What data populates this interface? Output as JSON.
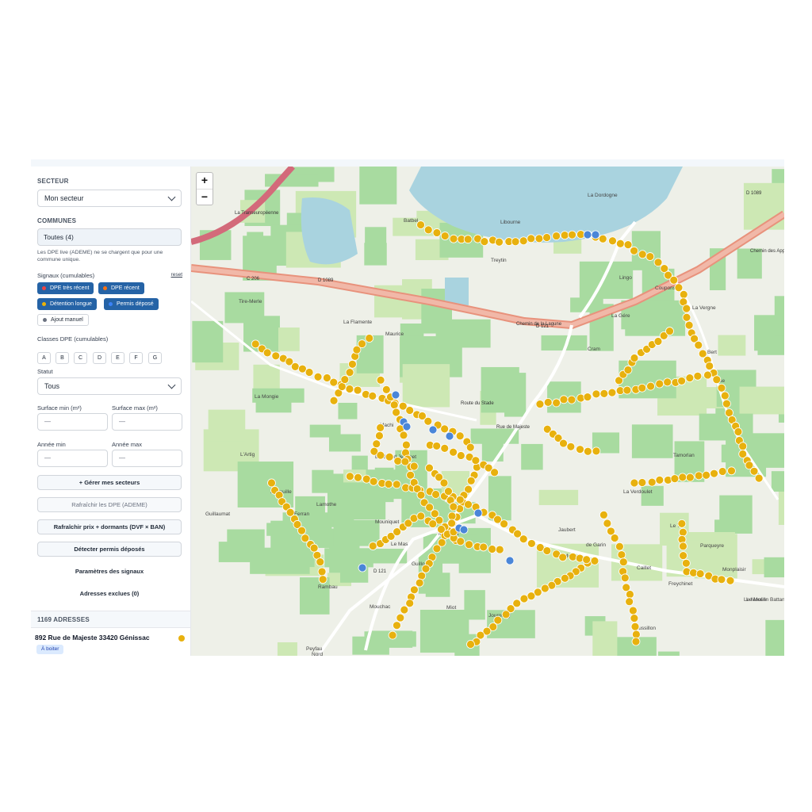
{
  "sidebar": {
    "secteur_label": "SECTEUR",
    "secteur_value": "Mon secteur",
    "communes_label": "COMMUNES",
    "communes_value": "Toutes (4)",
    "communes_note": "Les DPE live (ADEME) ne se chargent que pour une commune unique.",
    "signaux_label": "Signaux (cumulables)",
    "reset_label": "reset",
    "signals": [
      {
        "label": "DPE très récent",
        "dot": "#ef4444"
      },
      {
        "label": "DPE récent",
        "dot": "#f97316"
      },
      {
        "label": "Détention longue",
        "dot": "#eab308"
      },
      {
        "label": "Permis déposé",
        "dot": "#3b82f6"
      },
      {
        "label": "Ajout manuel",
        "dot": "#6b7280"
      }
    ],
    "classes_label": "Classes DPE (cumulables)",
    "classes": [
      "A",
      "B",
      "C",
      "D",
      "E",
      "F",
      "G"
    ],
    "statut_label": "Statut",
    "statut_value": "Tous",
    "surface_min_label": "Surface min (m²)",
    "surface_max_label": "Surface max (m²)",
    "surface_min_placeholder": "—",
    "surface_max_placeholder": "—",
    "annee_min_label": "Année min",
    "annee_max_label": "Année max",
    "annee_min_placeholder": "—",
    "annee_max_placeholder": "—",
    "buttons": {
      "gerer": "+ Gérer mes secteurs",
      "rafraichir_dpe": "Rafraîchir les DPE (ADEME)",
      "rafraichir_prix": "Rafraîchir prix + dormants (DVF × BAN)",
      "detecter": "Détecter permis déposés",
      "parametres": "Paramètres des signaux",
      "exclues": "Adresses exclues (0)"
    },
    "count_label": "1169 ADRESSES",
    "first_address": "892 Rue de Majeste 33420 Génissac",
    "first_address_badge": "À boiter",
    "first_address_dot": "#e8b10e"
  },
  "map": {
    "zoom_in": "+",
    "zoom_out": "−",
    "colors": {
      "detention": "#e8b10e",
      "permis": "#4a86d8",
      "vineyard": "#a8dba0",
      "field": "#cde8b4",
      "water": "#a9d3df",
      "motorway": "#e8927c"
    },
    "labels": [
      "La Dordogne",
      "Libourne",
      "Batbel",
      "Treytin",
      "Tire-Merle",
      "La Flamente",
      "Maurice",
      "La Mongie",
      "L'Artig",
      "Larreuille",
      "Lamothe",
      "Ferran",
      "Guillaumat",
      "Mouniquet",
      "Le Mas",
      "Guillon",
      "Rambau",
      "Mouchac",
      "Peyfau",
      "Nord",
      "Machi",
      "La Grand Jeannet",
      "Mongeat",
      "Miot",
      "Jourouley",
      "Tamorlan",
      "La Verdoulet",
      "Le Tr",
      "Parqueyre",
      "Caillet",
      "Monplaisir",
      "Freychinet",
      "Le Moulin Battant",
      "Roussillon",
      "de Garin",
      "Coupons",
      "La Vergne",
      "Cram",
      "La Gére",
      "Le Bert",
      "Lisse",
      "Lingo",
      "Tri",
      "Le Moulin",
      "Mot",
      "Jaubert"
    ],
    "roads": [
      "D 1089",
      "D 121",
      "C 206",
      "D 1089",
      "D 121",
      "La Transeuropéenne",
      "Chemin de la Lagune",
      "Route du Stade",
      "Rue de Majeste",
      "Chemin des Appeaux"
    ]
  }
}
